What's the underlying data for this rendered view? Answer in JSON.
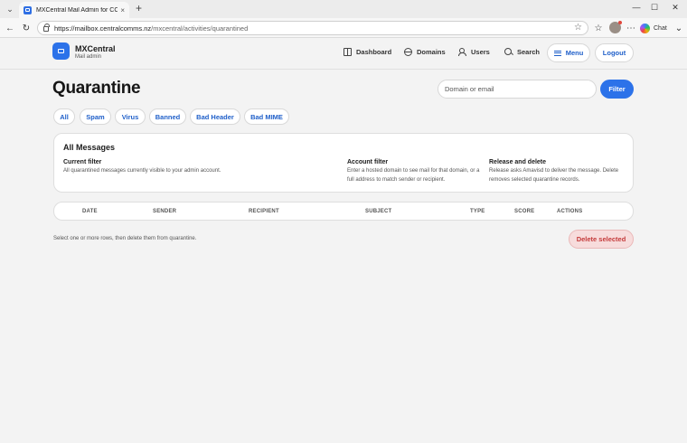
{
  "browser": {
    "tab_title": "MXCentral Mail Admin for CCL",
    "tab_close": "×",
    "new_tab": "+",
    "url_host": "https://mailbox.centralcomms.nz",
    "url_path": "/mxcentral/activities/quarantined",
    "chat_label": "Chat",
    "window_min": "—",
    "window_max": "☐",
    "window_close": "✕"
  },
  "header": {
    "brand_name": "MXCentral",
    "brand_sub": "Mail admin",
    "nav": [
      {
        "label": "Dashboard",
        "icon": "dashboard-icon"
      },
      {
        "label": "Domains",
        "icon": "globe-icon"
      },
      {
        "label": "Users",
        "icon": "users-icon"
      },
      {
        "label": "Search",
        "icon": "search-icon"
      }
    ],
    "menu_label": "Menu",
    "logout_label": "Logout"
  },
  "main": {
    "title": "Quarantine",
    "filter_placeholder": "Domain or email",
    "filter_button": "Filter",
    "chips": [
      "All",
      "Spam",
      "Virus",
      "Banned",
      "Bad Header",
      "Bad MIME"
    ]
  },
  "card": {
    "title": "All Messages",
    "columns": [
      {
        "heading": "Current filter",
        "text": "All quarantined messages currently visible to your admin account."
      },
      {
        "heading": "Account filter",
        "text": "Enter a hosted domain to see mail for that domain, or a full address to match sender or recipient."
      },
      {
        "heading": "Release and delete",
        "text": "Release asks Amavisd to deliver the message. Delete removes selected quarantine records."
      }
    ]
  },
  "table": {
    "headers": [
      "DATE",
      "SENDER",
      "RECIPIENT",
      "SUBJECT",
      "TYPE",
      "SCORE",
      "ACTIONS"
    ]
  },
  "footer": {
    "hint": "Select one or more rows, then delete them from quarantine.",
    "delete_label": "Delete selected"
  },
  "colors": {
    "accent": "#2c72e9",
    "link": "#1f5fc9",
    "danger": "#c43a3a",
    "danger_bg": "#f7dcdc"
  }
}
